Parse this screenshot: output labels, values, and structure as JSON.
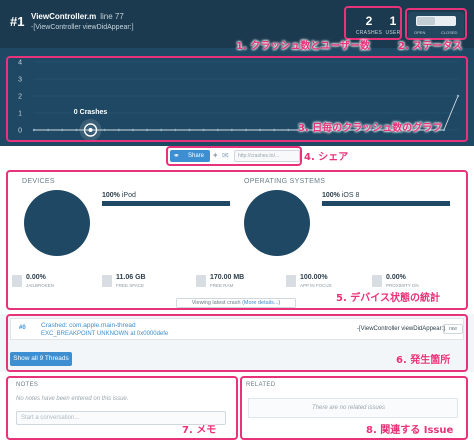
{
  "header": {
    "issue_number": "#1",
    "file_name": "ViewController.m",
    "line_label": "line 77",
    "method": "-[ViewController viewDidAppear:]",
    "crashes_count": "2",
    "crashes_label": "CRASHES",
    "users_count": "1",
    "users_label": "USER",
    "status_open_label": "OPEN",
    "status_closed_label": "CLOSED"
  },
  "chart_data": {
    "type": "line",
    "values": [
      0,
      0,
      0,
      0,
      0,
      0,
      0,
      0,
      0,
      0,
      0,
      0,
      0,
      0,
      0,
      0,
      0,
      0,
      0,
      0,
      0,
      0,
      0,
      0,
      0,
      0,
      0,
      0,
      0,
      0,
      2
    ],
    "highlight_index": 4,
    "highlight_label": "0 Crashes",
    "y_ticks": [
      "0",
      "1",
      "2",
      "3",
      "4"
    ],
    "ylim": [
      0,
      4
    ],
    "grid": true,
    "colors": {
      "background": "#1e4863",
      "line": "#ffffff",
      "grid": "#2f5d7b"
    }
  },
  "share": {
    "button_label": "Share",
    "url": "http://crashes.to/..."
  },
  "devices": {
    "devices_title": "DEVICES",
    "device_pct": "100%",
    "device_name": "iPod",
    "os_title": "OPERATING SYSTEMS",
    "os_pct": "100%",
    "os_name": "iOS 8",
    "stats": [
      {
        "value": "0.00%",
        "label": "JAILBROKEN"
      },
      {
        "value": "11.06 GB",
        "label": "FREE SPACE"
      },
      {
        "value": "170.00 MB",
        "label": "FREE RAM"
      },
      {
        "value": "100.00%",
        "label": "APP IN FOCUS"
      },
      {
        "value": "0.00%",
        "label": "PROXIMITY ON"
      }
    ],
    "viewing_text": "Viewing latest crash",
    "viewing_link": "(More details...)"
  },
  "crash": {
    "thread_number": "#0",
    "thread_name": "Crashed: com.apple.main-thread",
    "exception": "EXC_BREAKPOINT UNKNOWN at 0x0000defe",
    "method": "-[ViewController viewDidAppear:]",
    "raw_label": "raw",
    "show_threads_label": "Show all 9 Threads"
  },
  "notes": {
    "title": "NOTES",
    "empty": "No notes have been entered on this issue.",
    "placeholder": "Start a conversation..."
  },
  "related": {
    "title": "RELATED",
    "empty": "There are no related issues"
  },
  "annotations": {
    "a1": "1. クラッシュ数とユーザー数",
    "a2": "2. ステータス",
    "a3": "3. 日毎のクラッシュ数のグラフ",
    "a4": "4. シェア",
    "a5": "5. デバイス状態の統計",
    "a6": "6. 発生箇所",
    "a7": "7. メモ",
    "a8": "8. 関連する Issue"
  }
}
